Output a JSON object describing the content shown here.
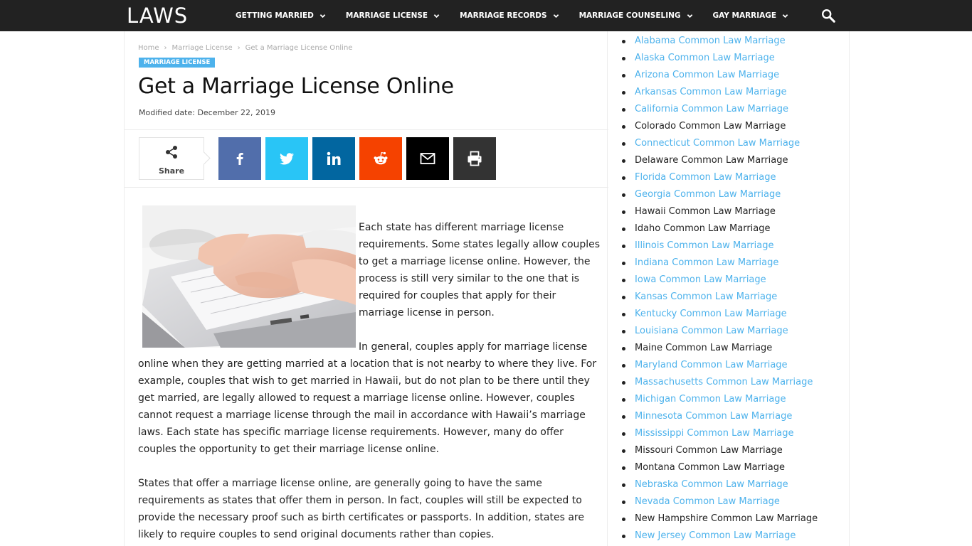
{
  "header": {
    "logo": "LAWS",
    "nav": [
      {
        "label": "GETTING MARRIED"
      },
      {
        "label": "MARRIAGE LICENSE"
      },
      {
        "label": "MARRIAGE RECORDS"
      },
      {
        "label": "MARRIAGE COUNSELING"
      },
      {
        "label": "GAY MARRIAGE"
      }
    ]
  },
  "breadcrumb": [
    "Home",
    "Marriage License",
    "Get a Marriage License Online"
  ],
  "category": "MARRIAGE LICENSE",
  "title": "Get a Marriage License Online",
  "modified": "Modified date: December 22, 2019",
  "share": {
    "label": "Share",
    "buttons": [
      {
        "name": "facebook",
        "color": "#516eab"
      },
      {
        "name": "twitter",
        "color": "#29c5f6"
      },
      {
        "name": "linkedin",
        "color": "#0266a0"
      },
      {
        "name": "reddit",
        "color": "#f54200"
      },
      {
        "name": "email",
        "color": "#000000"
      },
      {
        "name": "print",
        "color": "#333333"
      }
    ]
  },
  "article": {
    "p1": "Each state has different marriage license requirements. Some states legally allow couples to get a marriage license online. However, the process is still very similar to the one that is required for couples that apply for their marriage license in person.",
    "p2_start": "In general, couples apply for  marriage license",
    "p2_rest": "online when they are getting married at a location that is not nearby to where they live. For example, couples that wish to get married in Hawaii, but do not plan to be there until they get married, are legally allowed to request a marriage license online. However, couples cannot request a marriage license through the mail in accordance with Hawaii’s marriage laws. Each state has specific marriage license requirements. However, many do offer couples the opportunity to get their marriage license online.",
    "p3": "States that offer a marriage license online, are generally going to have the same requirements as states that offer them in person. In fact, couples will still be expected to provide the necessary proof such as birth certificates or passports. In addition, states are likely to require couples to send original documents rather than copies."
  },
  "sidebar": {
    "items": [
      {
        "label": "Alabama Common Law Marriage",
        "link": true
      },
      {
        "label": "Alaska Common Law Marriage",
        "link": true
      },
      {
        "label": "Arizona Common Law Marriage",
        "link": true
      },
      {
        "label": "Arkansas Common Law Marriage",
        "link": true
      },
      {
        "label": "California Common Law Marriage",
        "link": true
      },
      {
        "label": "Colorado Common Law Marriage",
        "link": false
      },
      {
        "label": "Connecticut Common Law Marriage",
        "link": true
      },
      {
        "label": "Delaware Common Law Marriage",
        "link": false
      },
      {
        "label": "Florida Common Law Marriage",
        "link": true
      },
      {
        "label": "Georgia Common Law Marriage",
        "link": true
      },
      {
        "label": "Hawaii Common Law Marriage",
        "link": false
      },
      {
        "label": "Idaho Common Law Marriage",
        "link": false
      },
      {
        "label": "Illinois Common Law Marriage",
        "link": true
      },
      {
        "label": "Indiana Common Law Marriage",
        "link": true
      },
      {
        "label": "Iowa Common Law Marriage",
        "link": true
      },
      {
        "label": "Kansas Common Law Marriage",
        "link": true
      },
      {
        "label": "Kentucky Common Law Marriage",
        "link": true
      },
      {
        "label": "Louisiana Common Law Marriage",
        "link": true
      },
      {
        "label": "Maine Common Law Marriage",
        "link": false
      },
      {
        "label": "Maryland Common Law Marriage",
        "link": true
      },
      {
        "label": "Massachusetts Common Law Marriage",
        "link": true
      },
      {
        "label": "Michigan Common Law Marriage",
        "link": true
      },
      {
        "label": "Minnesota Common Law Marriage",
        "link": true
      },
      {
        "label": "Mississippi Common Law Marriage",
        "link": true
      },
      {
        "label": "Missouri Common Law Marriage",
        "link": false
      },
      {
        "label": "Montana Common Law Marriage",
        "link": false
      },
      {
        "label": "Nebraska Common Law Marriage",
        "link": true
      },
      {
        "label": "Nevada Common Law Marriage",
        "link": true
      },
      {
        "label": "New Hampshire Common Law Marriage",
        "link": false
      },
      {
        "label": "New Jersey Common Law Marriage",
        "link": true
      }
    ]
  },
  "colors": {
    "accent": "#4db2ec",
    "topbar": "#222222"
  }
}
